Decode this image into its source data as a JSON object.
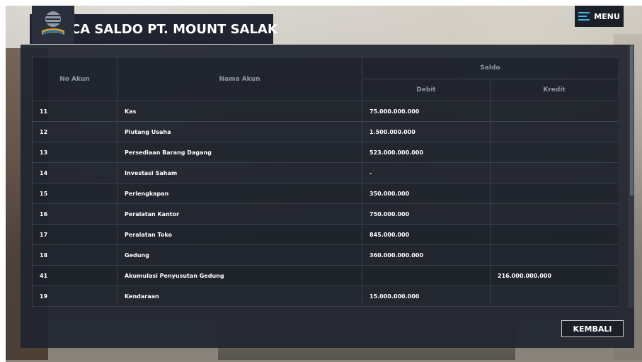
{
  "header": {
    "title": "CA SALDO PT. MOUNT SALAK"
  },
  "menu": {
    "label": "MENU"
  },
  "table": {
    "col_no_akun": "No Akun",
    "col_nama_akun": "Nama Akun",
    "col_saldo": "Saldo",
    "col_debit": "Debit",
    "col_kredit": "Kredit",
    "rows": [
      {
        "no": "11",
        "nama": "Kas",
        "debit": "75.000.000.000",
        "kredit": ""
      },
      {
        "no": "12",
        "nama": "Piutang Usaha",
        "debit": "1.500.000.000",
        "kredit": ""
      },
      {
        "no": "13",
        "nama": "Persediaan Barang Dagang",
        "debit": "523.000.000.000",
        "kredit": ""
      },
      {
        "no": "14",
        "nama": "Investasi Saham",
        "debit": "-",
        "kredit": ""
      },
      {
        "no": "15",
        "nama": "Perlengkapan",
        "debit": "350.000.000",
        "kredit": ""
      },
      {
        "no": "16",
        "nama": "Peralatan Kantor",
        "debit": "750.000.000",
        "kredit": ""
      },
      {
        "no": "17",
        "nama": "Peralatan Toko",
        "debit": "845.000.000",
        "kredit": ""
      },
      {
        "no": "18",
        "nama": "Gedung",
        "debit": "360.000.000.000",
        "kredit": ""
      },
      {
        "no": "41",
        "nama": "Akumulasi Penyusutan Gedung",
        "debit": "",
        "kredit": "216.000.000.000"
      },
      {
        "no": "19",
        "nama": "Kendaraan",
        "debit": "15.000.000.000",
        "kredit": ""
      },
      {
        "no": "",
        "nama": "",
        "debit": "",
        "kredit": ""
      }
    ]
  },
  "footer": {
    "back_label": "KEMBALI"
  },
  "colors": {
    "accent": "#3fb4e6",
    "panel": "#20252e"
  },
  "icons": {
    "logo": "book-logo-icon",
    "menu": "hamburger-icon"
  }
}
